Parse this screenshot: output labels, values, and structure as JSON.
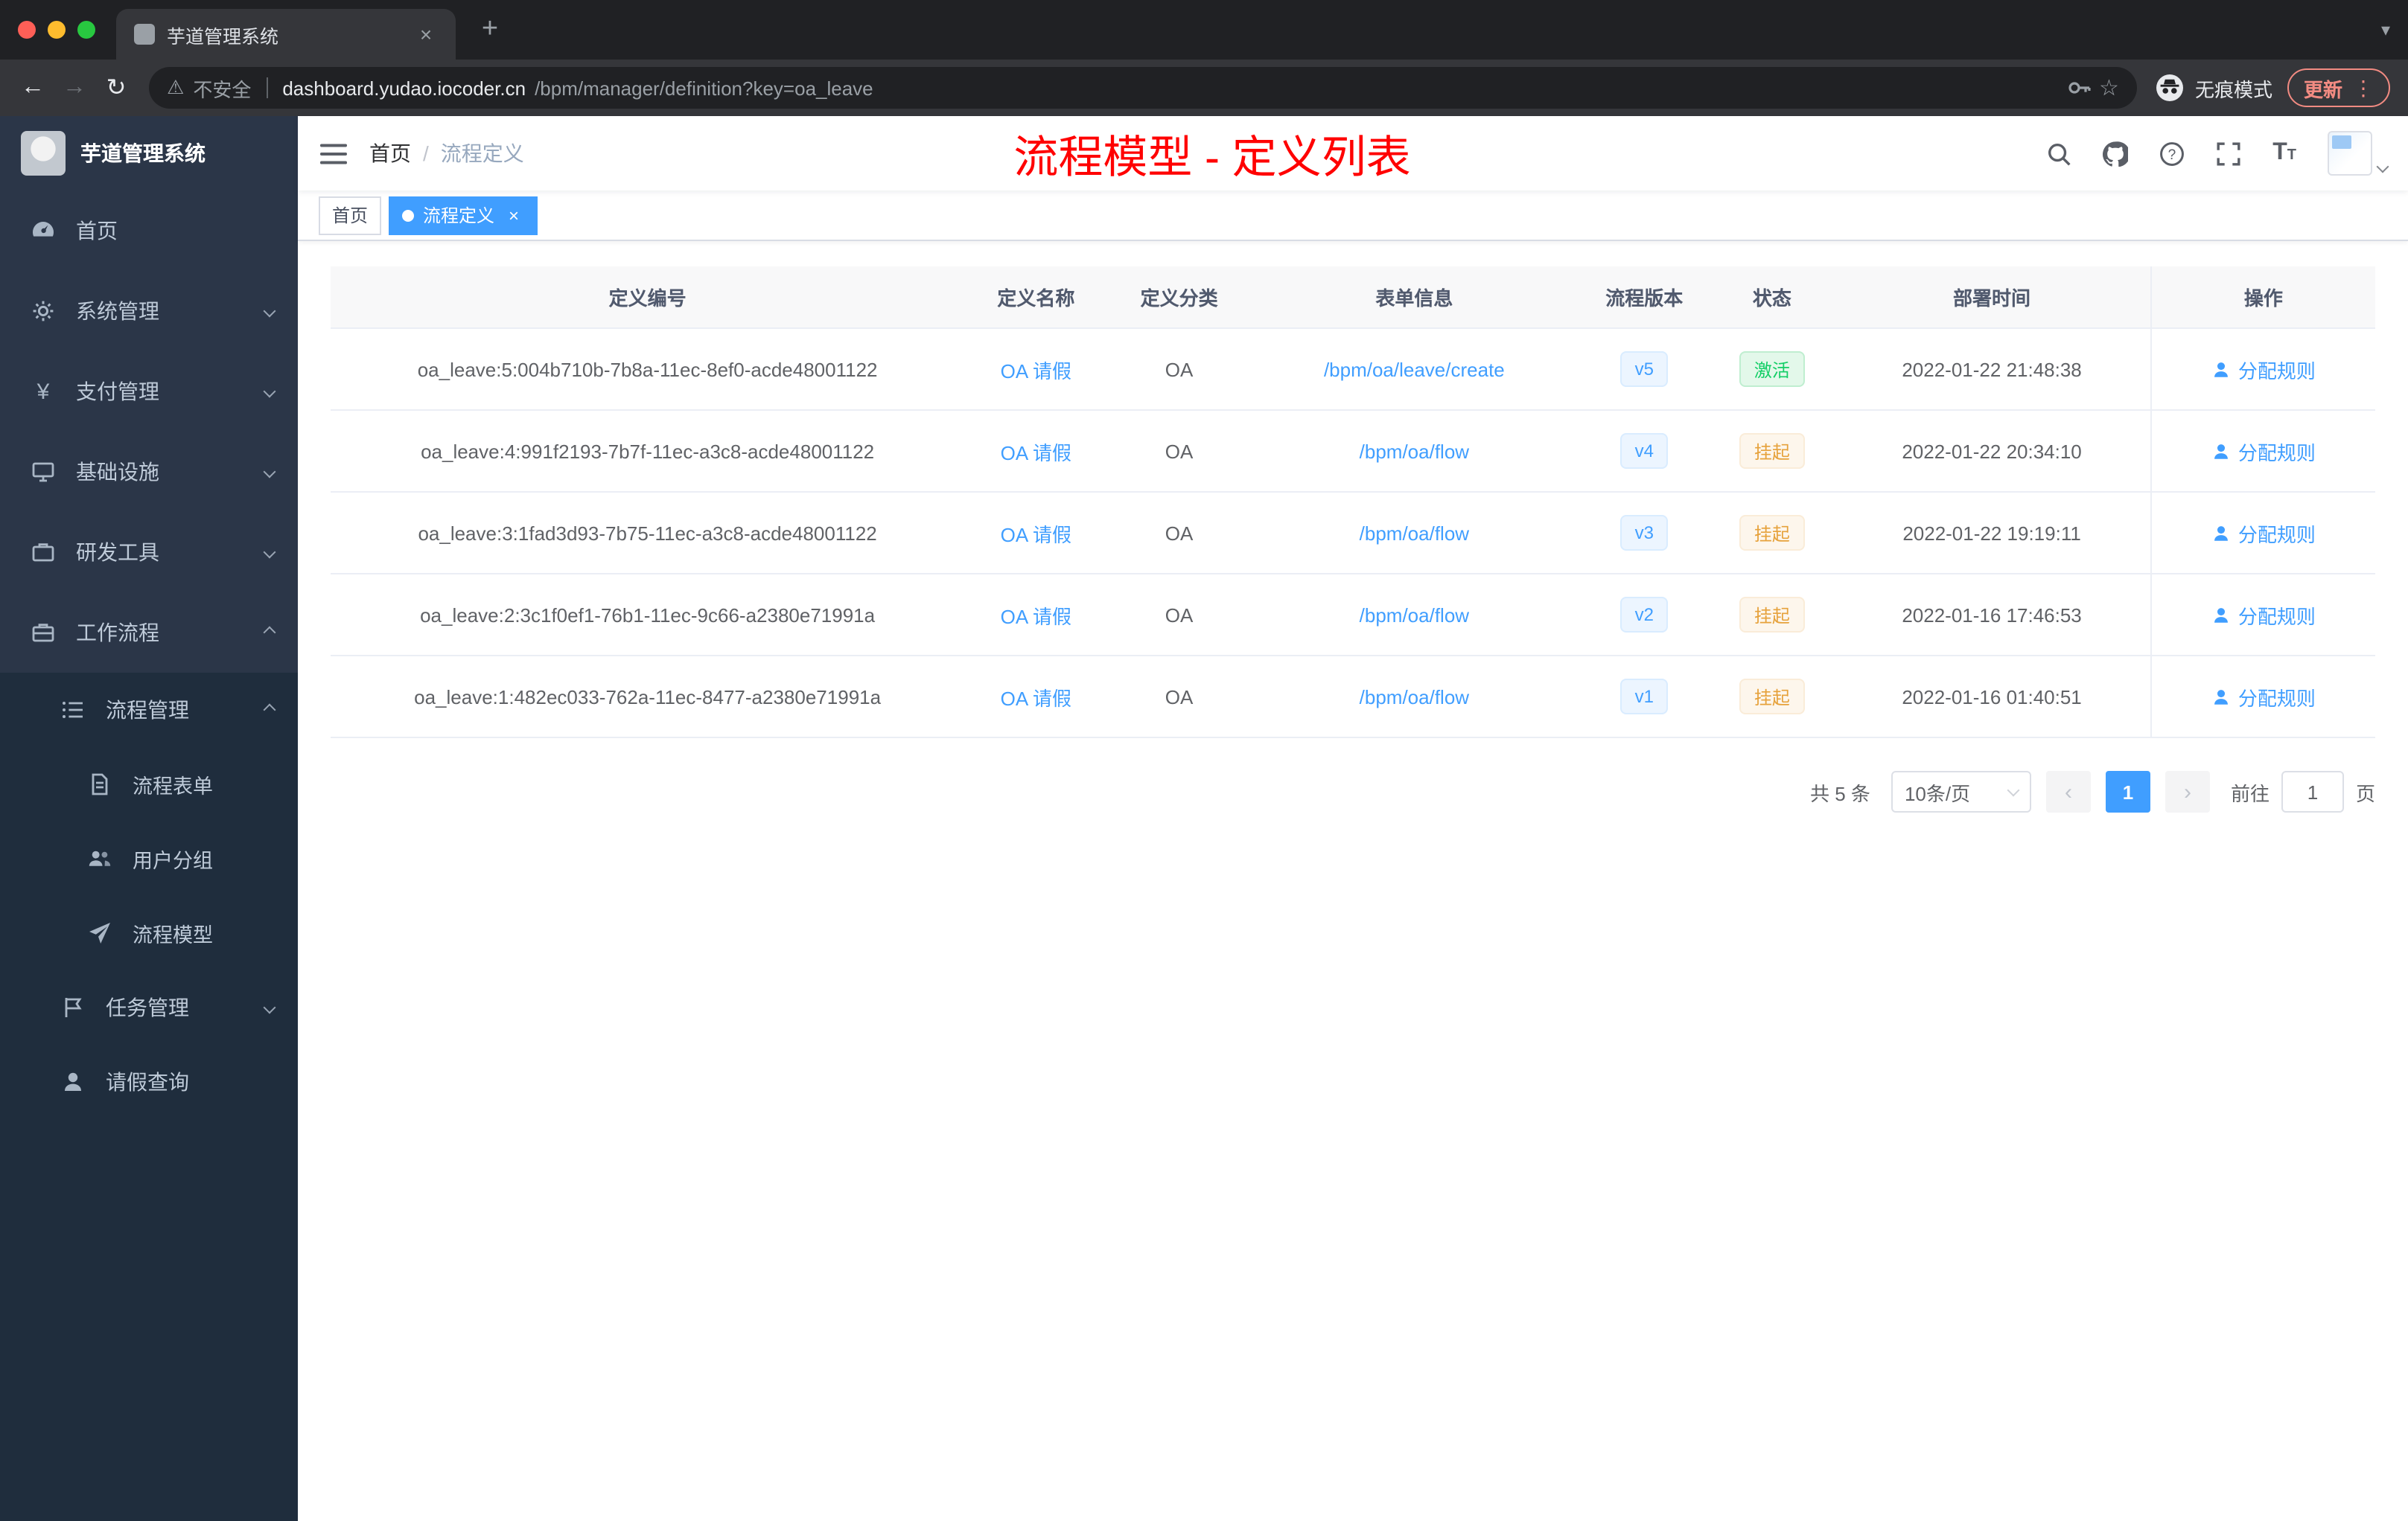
{
  "browser": {
    "tab_title": "芋道管理系统",
    "url_host": "dashboard.yudao.iocoder.cn",
    "url_path": "/bpm/manager/definition?key=oa_leave",
    "security_label": "不安全",
    "incognito_label": "无痕模式",
    "update_label": "更新"
  },
  "icons": {
    "back": "←",
    "forward": "→",
    "reload": "↻",
    "warning": "⚠",
    "star": "☆",
    "menu_dots": "⋮",
    "plus": "+",
    "close": "×",
    "chevron_down": "▾",
    "question": "?",
    "font_size": "T",
    "prev": "‹",
    "next": "›",
    "yen": "¥"
  },
  "sidebar": {
    "logo_title": "芋道管理系统",
    "items": [
      {
        "label": "首页"
      },
      {
        "label": "系统管理"
      },
      {
        "label": "支付管理"
      },
      {
        "label": "基础设施"
      },
      {
        "label": "研发工具"
      },
      {
        "label": "工作流程"
      },
      {
        "label": "流程管理"
      },
      {
        "label": "流程表单"
      },
      {
        "label": "用户分组"
      },
      {
        "label": "流程模型"
      },
      {
        "label": "任务管理"
      },
      {
        "label": "请假查询"
      }
    ]
  },
  "header": {
    "breadcrumb_home": "首页",
    "breadcrumb_separator": "/",
    "breadcrumb_current": "流程定义",
    "annotation": "流程模型 - 定义列表"
  },
  "tags": [
    {
      "label": "首页",
      "active": false
    },
    {
      "label": "流程定义",
      "active": true
    }
  ],
  "table": {
    "columns": [
      "定义编号",
      "定义名称",
      "定义分类",
      "表单信息",
      "流程版本",
      "状态",
      "部署时间",
      "操作"
    ],
    "action_label": "分配规则",
    "rows": [
      {
        "id": "oa_leave:5:004b710b-7b8a-11ec-8ef0-acde48001122",
        "name": "OA 请假",
        "category": "OA",
        "form": "/bpm/oa/leave/create",
        "version": "v5",
        "status": "激活",
        "status_type": "success",
        "time": "2022-01-22 21:48:38"
      },
      {
        "id": "oa_leave:4:991f2193-7b7f-11ec-a3c8-acde48001122",
        "name": "OA 请假",
        "category": "OA",
        "form": "/bpm/oa/flow",
        "version": "v4",
        "status": "挂起",
        "status_type": "warning",
        "time": "2022-01-22 20:34:10"
      },
      {
        "id": "oa_leave:3:1fad3d93-7b75-11ec-a3c8-acde48001122",
        "name": "OA 请假",
        "category": "OA",
        "form": "/bpm/oa/flow",
        "version": "v3",
        "status": "挂起",
        "status_type": "warning",
        "time": "2022-01-22 19:19:11"
      },
      {
        "id": "oa_leave:2:3c1f0ef1-76b1-11ec-9c66-a2380e71991a",
        "name": "OA 请假",
        "category": "OA",
        "form": "/bpm/oa/flow",
        "version": "v2",
        "status": "挂起",
        "status_type": "warning",
        "time": "2022-01-16 17:46:53"
      },
      {
        "id": "oa_leave:1:482ec033-762a-11ec-8477-a2380e71991a",
        "name": "OA 请假",
        "category": "OA",
        "form": "/bpm/oa/flow",
        "version": "v1",
        "status": "挂起",
        "status_type": "warning",
        "time": "2022-01-16 01:40:51"
      }
    ]
  },
  "pagination": {
    "total": "共 5 条",
    "page_size": "10条/页",
    "current_page": "1",
    "goto_label": "前往",
    "goto_value": "1",
    "page_unit": "页"
  },
  "theme": {
    "accent": "#409eff",
    "success": "#13ce66",
    "warning": "#e6a23c",
    "annotation_red": "#ff0000",
    "sidebar_bg": "#1f2d3d",
    "sidebar_item_bg": "#2b3648"
  }
}
